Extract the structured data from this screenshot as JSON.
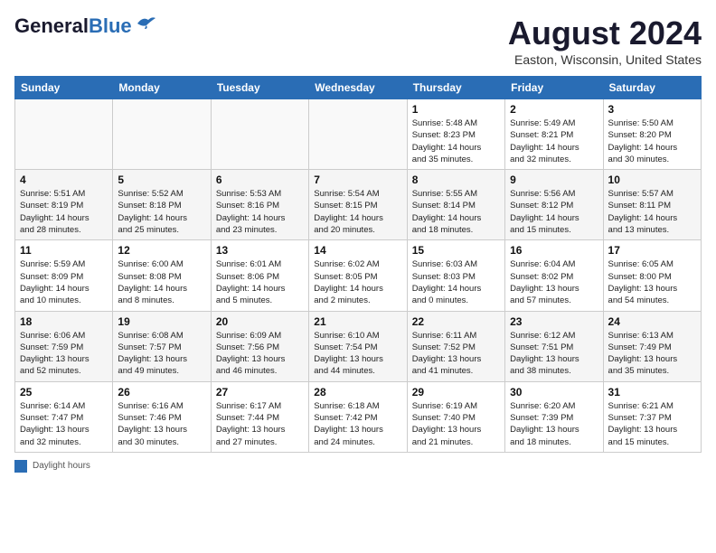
{
  "header": {
    "logo_line1": "General",
    "logo_line2": "Blue",
    "month": "August 2024",
    "location": "Easton, Wisconsin, United States"
  },
  "days_of_week": [
    "Sunday",
    "Monday",
    "Tuesday",
    "Wednesday",
    "Thursday",
    "Friday",
    "Saturday"
  ],
  "weeks": [
    [
      {
        "day": "",
        "info": ""
      },
      {
        "day": "",
        "info": ""
      },
      {
        "day": "",
        "info": ""
      },
      {
        "day": "",
        "info": ""
      },
      {
        "day": "1",
        "info": "Sunrise: 5:48 AM\nSunset: 8:23 PM\nDaylight: 14 hours\nand 35 minutes."
      },
      {
        "day": "2",
        "info": "Sunrise: 5:49 AM\nSunset: 8:21 PM\nDaylight: 14 hours\nand 32 minutes."
      },
      {
        "day": "3",
        "info": "Sunrise: 5:50 AM\nSunset: 8:20 PM\nDaylight: 14 hours\nand 30 minutes."
      }
    ],
    [
      {
        "day": "4",
        "info": "Sunrise: 5:51 AM\nSunset: 8:19 PM\nDaylight: 14 hours\nand 28 minutes."
      },
      {
        "day": "5",
        "info": "Sunrise: 5:52 AM\nSunset: 8:18 PM\nDaylight: 14 hours\nand 25 minutes."
      },
      {
        "day": "6",
        "info": "Sunrise: 5:53 AM\nSunset: 8:16 PM\nDaylight: 14 hours\nand 23 minutes."
      },
      {
        "day": "7",
        "info": "Sunrise: 5:54 AM\nSunset: 8:15 PM\nDaylight: 14 hours\nand 20 minutes."
      },
      {
        "day": "8",
        "info": "Sunrise: 5:55 AM\nSunset: 8:14 PM\nDaylight: 14 hours\nand 18 minutes."
      },
      {
        "day": "9",
        "info": "Sunrise: 5:56 AM\nSunset: 8:12 PM\nDaylight: 14 hours\nand 15 minutes."
      },
      {
        "day": "10",
        "info": "Sunrise: 5:57 AM\nSunset: 8:11 PM\nDaylight: 14 hours\nand 13 minutes."
      }
    ],
    [
      {
        "day": "11",
        "info": "Sunrise: 5:59 AM\nSunset: 8:09 PM\nDaylight: 14 hours\nand 10 minutes."
      },
      {
        "day": "12",
        "info": "Sunrise: 6:00 AM\nSunset: 8:08 PM\nDaylight: 14 hours\nand 8 minutes."
      },
      {
        "day": "13",
        "info": "Sunrise: 6:01 AM\nSunset: 8:06 PM\nDaylight: 14 hours\nand 5 minutes."
      },
      {
        "day": "14",
        "info": "Sunrise: 6:02 AM\nSunset: 8:05 PM\nDaylight: 14 hours\nand 2 minutes."
      },
      {
        "day": "15",
        "info": "Sunrise: 6:03 AM\nSunset: 8:03 PM\nDaylight: 14 hours\nand 0 minutes."
      },
      {
        "day": "16",
        "info": "Sunrise: 6:04 AM\nSunset: 8:02 PM\nDaylight: 13 hours\nand 57 minutes."
      },
      {
        "day": "17",
        "info": "Sunrise: 6:05 AM\nSunset: 8:00 PM\nDaylight: 13 hours\nand 54 minutes."
      }
    ],
    [
      {
        "day": "18",
        "info": "Sunrise: 6:06 AM\nSunset: 7:59 PM\nDaylight: 13 hours\nand 52 minutes."
      },
      {
        "day": "19",
        "info": "Sunrise: 6:08 AM\nSunset: 7:57 PM\nDaylight: 13 hours\nand 49 minutes."
      },
      {
        "day": "20",
        "info": "Sunrise: 6:09 AM\nSunset: 7:56 PM\nDaylight: 13 hours\nand 46 minutes."
      },
      {
        "day": "21",
        "info": "Sunrise: 6:10 AM\nSunset: 7:54 PM\nDaylight: 13 hours\nand 44 minutes."
      },
      {
        "day": "22",
        "info": "Sunrise: 6:11 AM\nSunset: 7:52 PM\nDaylight: 13 hours\nand 41 minutes."
      },
      {
        "day": "23",
        "info": "Sunrise: 6:12 AM\nSunset: 7:51 PM\nDaylight: 13 hours\nand 38 minutes."
      },
      {
        "day": "24",
        "info": "Sunrise: 6:13 AM\nSunset: 7:49 PM\nDaylight: 13 hours\nand 35 minutes."
      }
    ],
    [
      {
        "day": "25",
        "info": "Sunrise: 6:14 AM\nSunset: 7:47 PM\nDaylight: 13 hours\nand 32 minutes."
      },
      {
        "day": "26",
        "info": "Sunrise: 6:16 AM\nSunset: 7:46 PM\nDaylight: 13 hours\nand 30 minutes."
      },
      {
        "day": "27",
        "info": "Sunrise: 6:17 AM\nSunset: 7:44 PM\nDaylight: 13 hours\nand 27 minutes."
      },
      {
        "day": "28",
        "info": "Sunrise: 6:18 AM\nSunset: 7:42 PM\nDaylight: 13 hours\nand 24 minutes."
      },
      {
        "day": "29",
        "info": "Sunrise: 6:19 AM\nSunset: 7:40 PM\nDaylight: 13 hours\nand 21 minutes."
      },
      {
        "day": "30",
        "info": "Sunrise: 6:20 AM\nSunset: 7:39 PM\nDaylight: 13 hours\nand 18 minutes."
      },
      {
        "day": "31",
        "info": "Sunrise: 6:21 AM\nSunset: 7:37 PM\nDaylight: 13 hours\nand 15 minutes."
      }
    ]
  ],
  "footer": {
    "label": "Daylight hours"
  }
}
